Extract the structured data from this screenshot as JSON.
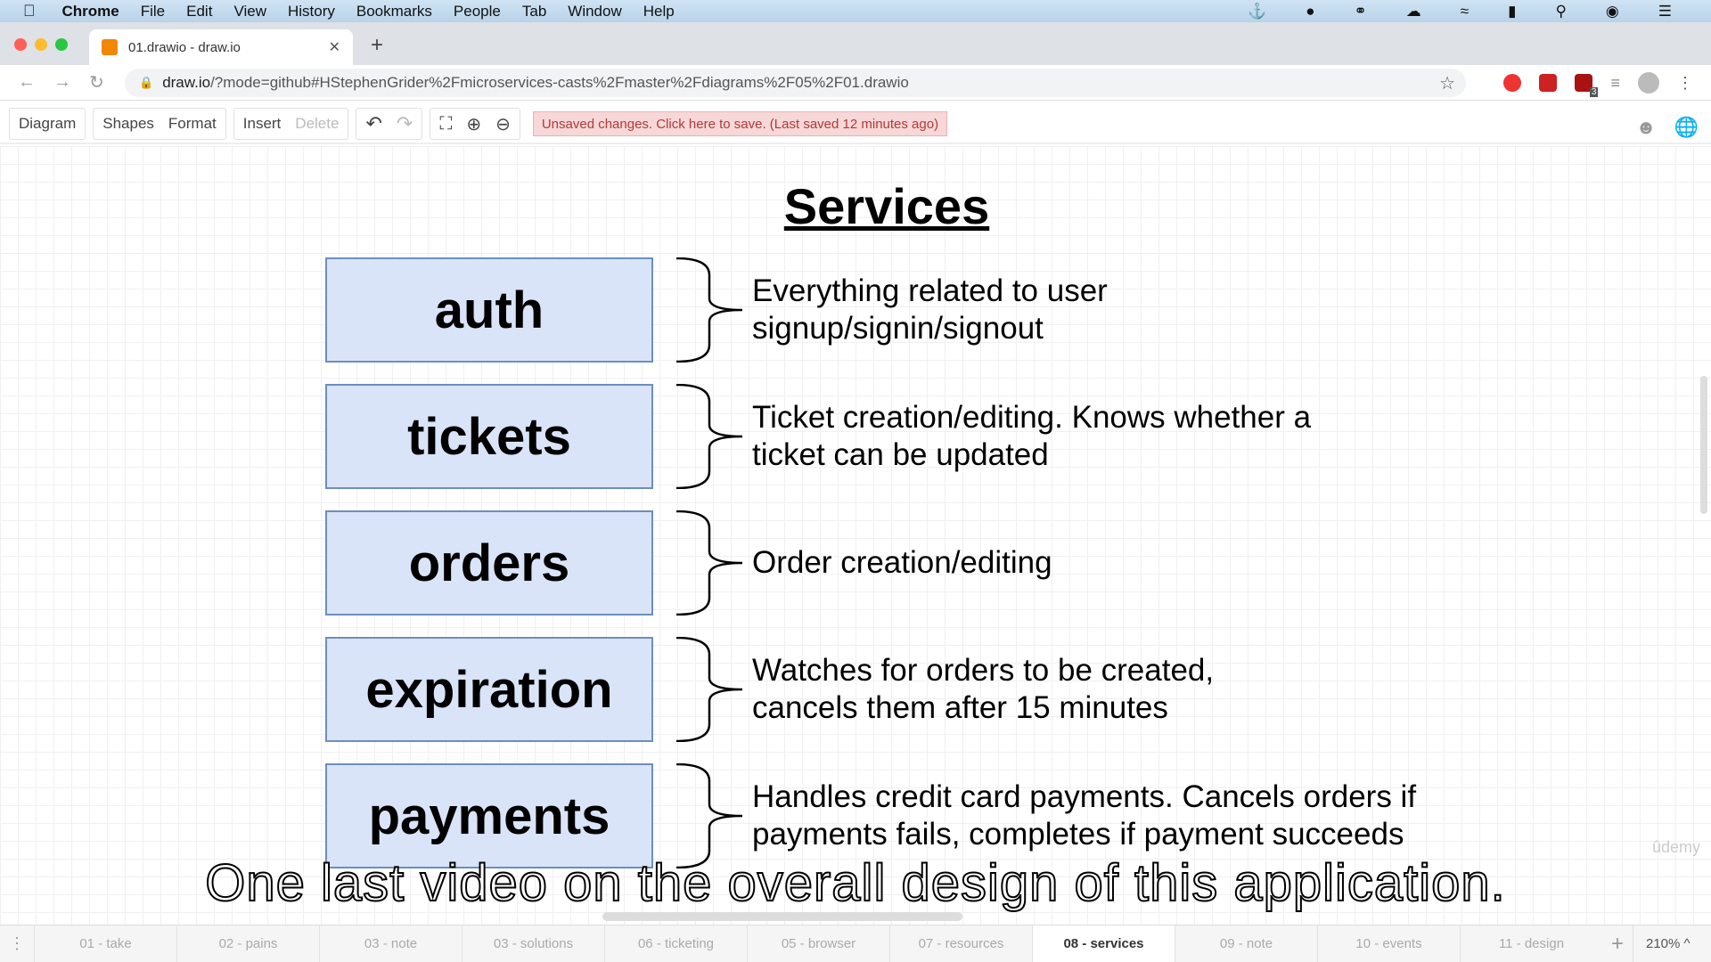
{
  "menubar": {
    "app": "Chrome",
    "items": [
      "File",
      "Edit",
      "View",
      "History",
      "Bookmarks",
      "People",
      "Tab",
      "Window",
      "Help"
    ]
  },
  "browser": {
    "tab_title": "01.drawio - draw.io",
    "url_host": "draw.io",
    "url_rest": "/?mode=github#HStephenGrider%2Fmicroservices-casts%2Fmaster%2Fdiagrams%2F05%2F01.drawio",
    "ext_badge": "3"
  },
  "toolbar": {
    "diagram": "Diagram",
    "shapes": "Shapes",
    "format": "Format",
    "insert": "Insert",
    "delete": "Delete",
    "unsaved": "Unsaved changes. Click here to save. (Last saved 12 minutes ago)"
  },
  "diagram": {
    "title": "Services",
    "services": [
      {
        "name": "auth",
        "lines": [
          "Everything related to user",
          "signup/signin/signout"
        ]
      },
      {
        "name": "tickets",
        "lines": [
          "Ticket creation/editing.  Knows whether a",
          "ticket can be updated"
        ]
      },
      {
        "name": "orders",
        "lines": [
          "Order creation/editing"
        ]
      },
      {
        "name": "expiration",
        "lines": [
          "Watches for orders to be created,",
          "cancels them after 15 minutes"
        ]
      },
      {
        "name": "payments",
        "lines": [
          "Handles credit card payments.  Cancels orders if",
          "payments fails, completes if payment succeeds"
        ]
      }
    ],
    "box_fill": "#dae4f8",
    "box_stroke": "#6c8ebf"
  },
  "caption": "One last video on the overall design of this application.",
  "watermark": "ûdemy",
  "pages": [
    "01 - take",
    "02 - pains",
    "03 - note",
    "03 - solutions",
    "06 - ticketing",
    "05 - browser",
    "07 - resources",
    "08 - services",
    "09 - note",
    "10 - events",
    "11 - design"
  ],
  "active_page": "08 - services",
  "zoom": "210%"
}
